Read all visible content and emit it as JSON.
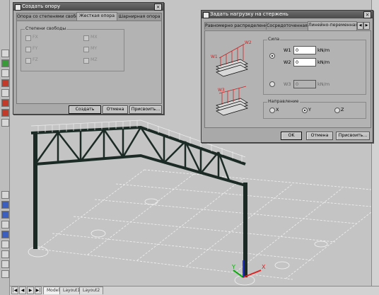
{
  "support_dialog": {
    "title": "Создать опору",
    "tabs": [
      "Опора со степенями свободы",
      "Жесткая опора",
      "Шарнирная опора"
    ],
    "group_label": "Степени свободы",
    "checks": [
      {
        "label": "FX"
      },
      {
        "label": "MX"
      },
      {
        "label": "FY"
      },
      {
        "label": "MY"
      },
      {
        "label": "FZ"
      },
      {
        "label": "MZ"
      }
    ],
    "buttons": {
      "create": "Создать",
      "cancel": "Отмена",
      "assign": "Присвоить..."
    }
  },
  "load_dialog": {
    "title": "Задать нагрузку на стержень",
    "tabs": [
      "Равномерно распределенная",
      "Сосредоточенная",
      "Линейно-переменная"
    ],
    "diagram_labels": {
      "w1": "W1",
      "w2": "W2",
      "w3": "W3"
    },
    "force_group": "Сила",
    "fields": [
      {
        "label": "W1",
        "value": "0",
        "unit": "kN/m"
      },
      {
        "label": "W2",
        "value": "0",
        "unit": "kN/m"
      },
      {
        "label": "W3",
        "value": "0",
        "unit": "kN/m"
      }
    ],
    "direction_group": "Направление",
    "directions": [
      "X",
      "Y",
      "Z"
    ],
    "selected_direction": "Y",
    "buttons": {
      "ok": "OK",
      "cancel": "Отмена",
      "assign": "Присвоить..."
    }
  },
  "layout_tabs": [
    "Model",
    "Layout1",
    "Layout2"
  ],
  "axes": {
    "x": "X",
    "y": "Y"
  }
}
